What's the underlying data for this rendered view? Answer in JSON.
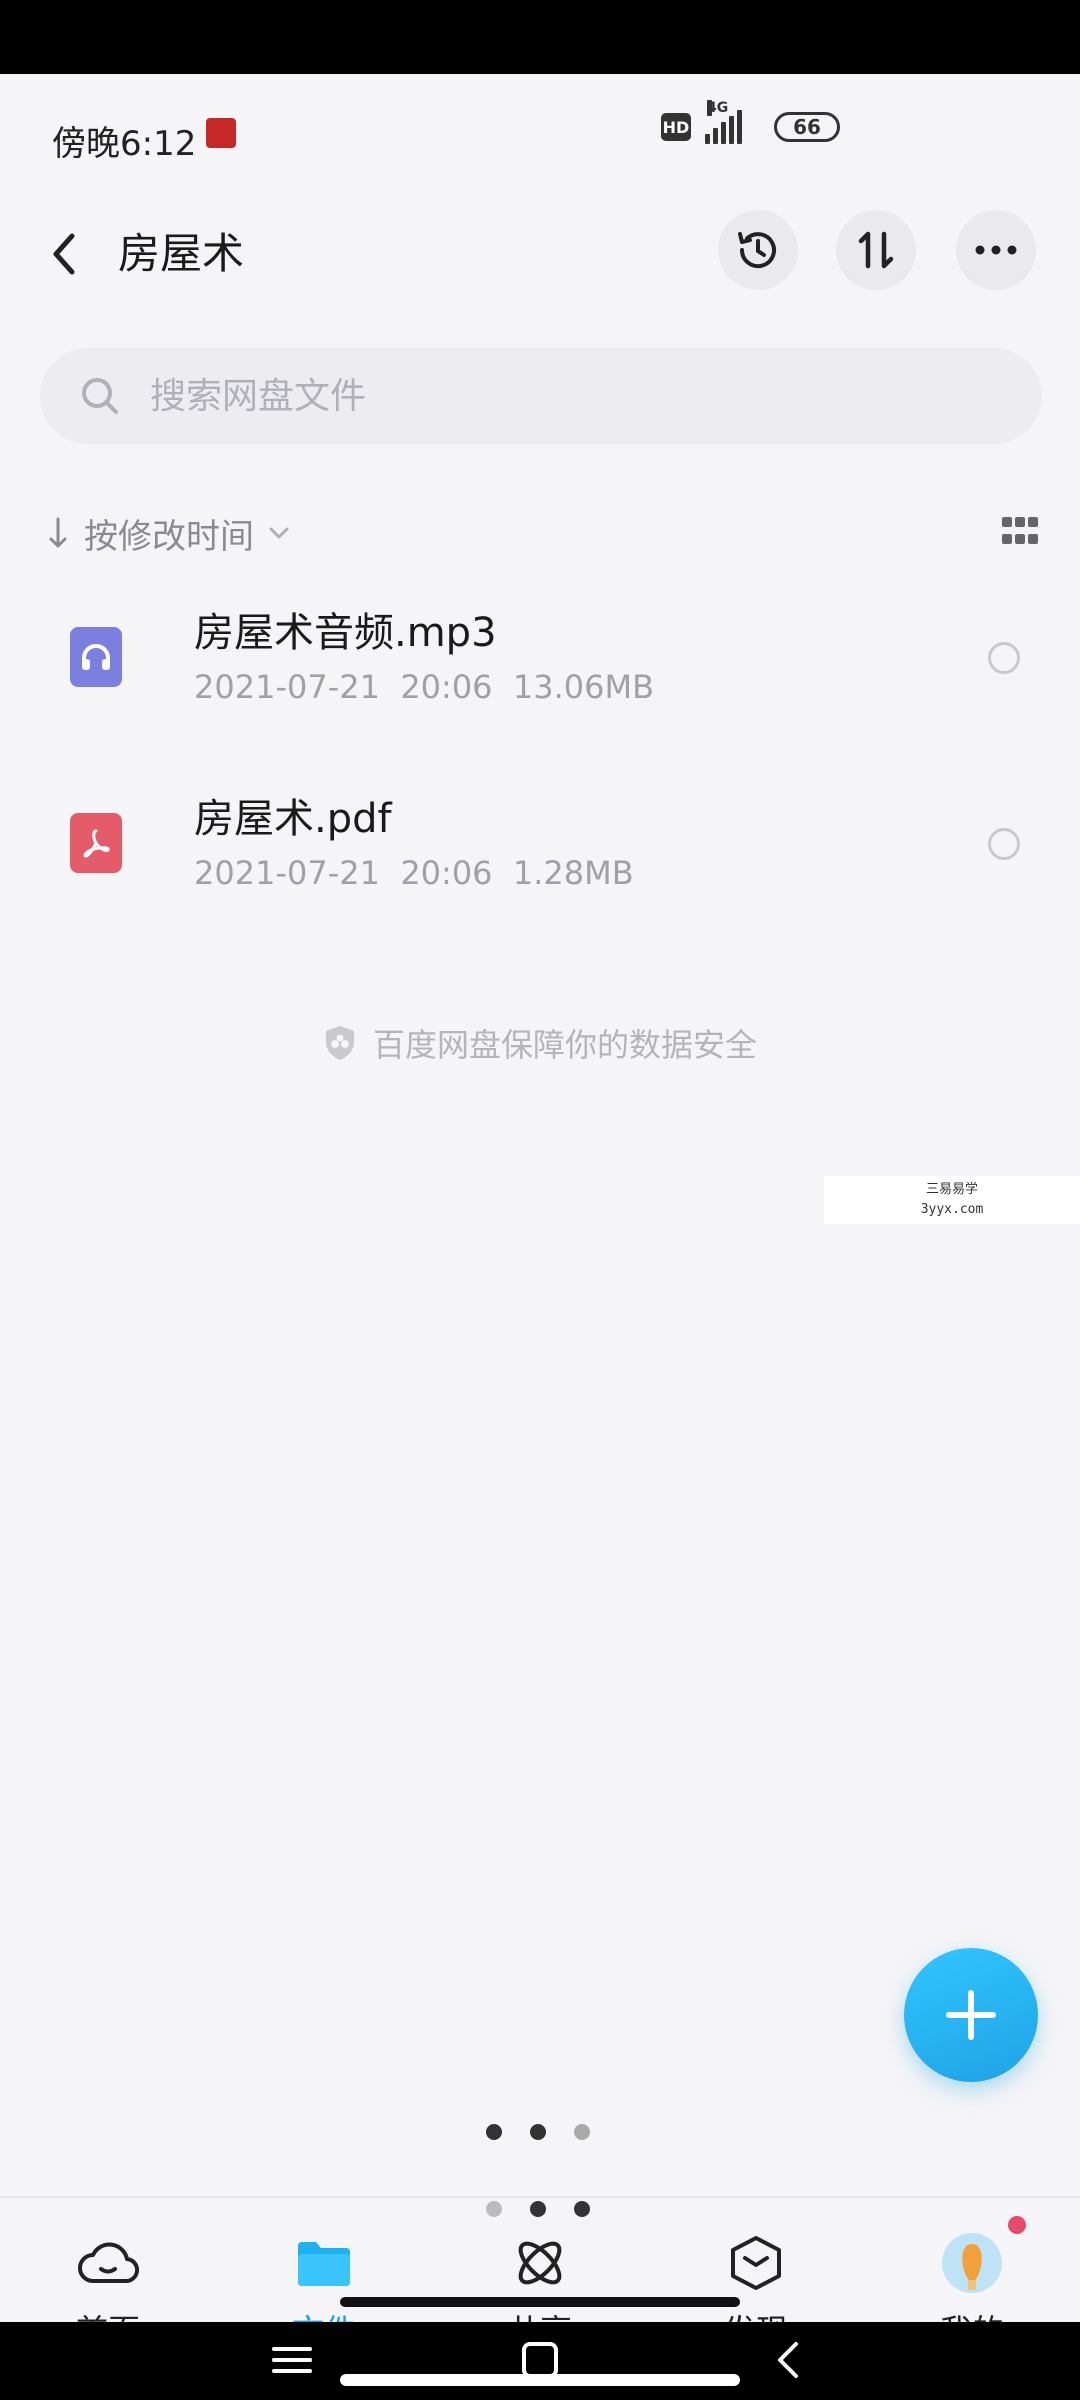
{
  "status_bar": {
    "time": "傍晚6:12",
    "hd": "HD",
    "network": "4G",
    "battery": "66"
  },
  "header": {
    "title": "房屋术",
    "back_icon": "chevron-left-icon",
    "history_icon": "history-icon",
    "transfer_icon": "transfer-icon",
    "more_icon": "more-icon"
  },
  "search": {
    "placeholder": "搜索网盘文件"
  },
  "sort": {
    "label": "按修改时间"
  },
  "files": [
    {
      "name": "房屋术音频.mp3",
      "date": "2021-07-21",
      "time": "20:06",
      "size": "13.06MB",
      "icon": "audio-file-icon",
      "icon_color": "#7b7fe0"
    },
    {
      "name": "房屋术.pdf",
      "date": "2021-07-21",
      "time": "20:06",
      "size": "1.28MB",
      "icon": "pdf-file-icon",
      "icon_color": "#e45c6a"
    }
  ],
  "security_note": "百度网盘保障你的数据安全",
  "watermark": {
    "line1": "三易易学",
    "line2": "3yyx.com"
  },
  "bottom_nav": [
    {
      "label": "首页",
      "icon": "home-cloud-icon",
      "active": false
    },
    {
      "label": "文件",
      "icon": "folder-icon",
      "active": true
    },
    {
      "label": "共享",
      "icon": "share-atom-icon",
      "active": false
    },
    {
      "label": "发现",
      "icon": "discover-box-icon",
      "active": false
    },
    {
      "label": "我的",
      "icon": "avatar-icon",
      "active": false
    }
  ],
  "colors": {
    "accent": "#16a2e4",
    "fab": "#1fa2e6"
  }
}
